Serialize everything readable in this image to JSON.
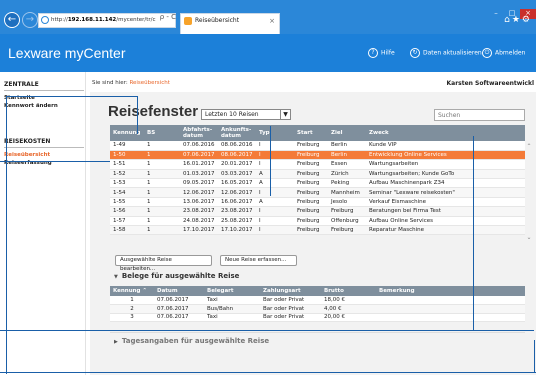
{
  "browser": {
    "url_host": "192.168.11.142",
    "url_path": "/mycenter/tr/c",
    "url_prefix": "http://",
    "addr_tools": "ρ - C",
    "tab_title": "Reiseübersicht",
    "tab_close": "×",
    "win_min": "–",
    "win_max": "□",
    "win_close": "×",
    "top_icons": "⌂★⚙"
  },
  "app": {
    "title": "Lexware myCenter",
    "help": "Hilfe",
    "refresh": "Daten aktualisieren",
    "logout": "Abmelden",
    "help_glyph": "?",
    "refresh_glyph": "↻",
    "logout_glyph": "⏻"
  },
  "sidebar": {
    "section1": "ZENTRALE",
    "items1": [
      "Startseite",
      "Kennwort ändern"
    ],
    "section2": "REISEKOSTEN",
    "items2": [
      "Reiseübersicht",
      "Reiseerfassung"
    ]
  },
  "breadcrumb": {
    "prefix": "Sie sind hier:",
    "current": "Reiseübersicht"
  },
  "company": "Karsten Softwareentwickl",
  "page": {
    "title": "Reisefenster",
    "filter_value": "Letzten 10 Reisen",
    "filter_arrow": "▼",
    "search_placeholder": "Suchen"
  },
  "trips": {
    "columns": [
      "Kennung",
      "BS",
      "Abfahrts-datum",
      "Ankunfts-datum",
      "Typ",
      "Start",
      "Ziel",
      "Zweck"
    ],
    "rows": [
      [
        "1-49",
        "1",
        "07.06.2016",
        "08.06.2016",
        "I",
        "Freiburg",
        "Berlin",
        "Kunde VIP"
      ],
      [
        "1-50",
        "1",
        "07.06.2017",
        "08.06.2017",
        "I",
        "Freiburg",
        "Berlin",
        "Entwicklung Online Services"
      ],
      [
        "1-51",
        "1",
        "16.01.2017",
        "20.01.2017",
        "I",
        "Freiburg",
        "Essen",
        "Wartungsarbeiten"
      ],
      [
        "1-52",
        "1",
        "01.03.2017",
        "03.03.2017",
        "A",
        "Freiburg",
        "Zürich",
        "Wartungsarbeiten; Kunde GoTo"
      ],
      [
        "1-53",
        "1",
        "09.05.2017",
        "16.05.2017",
        "A",
        "Freiburg",
        "Peking",
        "Aufbau Maschinenpark Z34"
      ],
      [
        "1-54",
        "1",
        "12.06.2017",
        "12.06.2017",
        "I",
        "Freiburg",
        "Mannheim",
        "Seminar \"Lexware reisekosten\""
      ],
      [
        "1-55",
        "1",
        "13.06.2017",
        "16.06.2017",
        "A",
        "Freiburg",
        "Jesolo",
        "Verkauf Eismaschine"
      ],
      [
        "1-56",
        "1",
        "23.08.2017",
        "23.08.2017",
        "I",
        "Freiburg",
        "Freiburg",
        "Beratungen bei Firma Test"
      ],
      [
        "1-57",
        "1",
        "24.08.2017",
        "25.08.2017",
        "I",
        "Freiburg",
        "Offenburg",
        "Aufbau Online Services"
      ],
      [
        "1-58",
        "1",
        "17.10.2017",
        "17.10.2017",
        "I",
        "Freiburg",
        "Freiburg",
        "Reparatur Maschine"
      ]
    ],
    "selected_index": 1
  },
  "buttons": {
    "edit": "Ausgewählte Reise bearbeiten...",
    "new": "Neue Reise erfassen..."
  },
  "receipts_section": {
    "title": "Belege für ausgewählte Reise",
    "toggle": "▼",
    "columns": [
      "Kennung ⌃",
      "Datum",
      "Belegart",
      "Zahlungsart",
      "Brutto",
      "Bemerkung"
    ],
    "rows": [
      [
        "1",
        "07.06.2017",
        "Taxi",
        "Bar oder Privat",
        "18,00 €",
        ""
      ],
      [
        "2",
        "07.06.2017",
        "Bus/Bahn",
        "Bar oder Privat",
        "4,00 €",
        ""
      ],
      [
        "3",
        "07.06.2017",
        "Taxi",
        "Bar oder Privat",
        "20,00 €",
        ""
      ]
    ]
  },
  "days_section": {
    "title": "Tagesangaben für ausgewählte Reise",
    "toggle": "▶"
  },
  "scroll": {
    "up": "⌃",
    "down": "⌄"
  }
}
